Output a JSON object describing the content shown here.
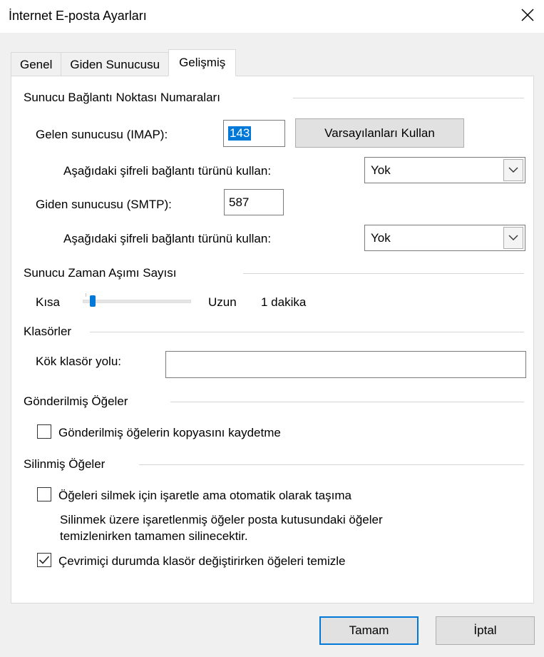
{
  "window": {
    "title": "İnternet E-posta Ayarları"
  },
  "tabs": [
    {
      "label": "Genel"
    },
    {
      "label": "Giden Sunucusu"
    },
    {
      "label": "Gelişmiş"
    }
  ],
  "ports": {
    "group_title": "Sunucu Bağlantı Noktası Numaraları",
    "incoming_label": "Gelen sunucusu (IMAP):",
    "incoming_value": "143",
    "defaults_button": "Varsayılanları Kullan",
    "incoming_enc_label": "Aşağıdaki şifreli bağlantı türünü kullan:",
    "incoming_enc_value": "Yok",
    "outgoing_label": "Giden sunucusu (SMTP):",
    "outgoing_value": "587",
    "outgoing_enc_label": "Aşağıdaki şifreli bağlantı türünü kullan:",
    "outgoing_enc_value": "Yok"
  },
  "timeout": {
    "group_title": "Sunucu Zaman Aşımı Sayısı",
    "short_label": "Kısa",
    "long_label": "Uzun",
    "value_text": "1 dakika",
    "slider_fraction": 0.07
  },
  "folders": {
    "group_title": "Klasörler",
    "root_label": "Kök klasör yolu:",
    "root_value": ""
  },
  "sent_items": {
    "group_title": "Gönderilmiş Öğeler",
    "dont_save_label": "Gönderilmiş öğelerin kopyasını kaydetme",
    "dont_save_checked": false
  },
  "deleted_items": {
    "group_title": "Silinmiş Öğeler",
    "mark_label": "Öğeleri silmek için işaretle ama otomatik olarak taşıma",
    "mark_checked": false,
    "note_line1": "Silinmek üzere işaretlenmiş öğeler posta kutusundaki öğeler",
    "note_line2": "temizlenirken tamamen silinecektir.",
    "purge_label": "Çevrimiçi durumda klasör değiştirirken öğeleri temizle",
    "purge_checked": true
  },
  "footer": {
    "ok_label": "Tamam",
    "cancel_label": "İptal"
  },
  "colors": {
    "accent": "#0078d7",
    "background": "#f0f0f0"
  }
}
